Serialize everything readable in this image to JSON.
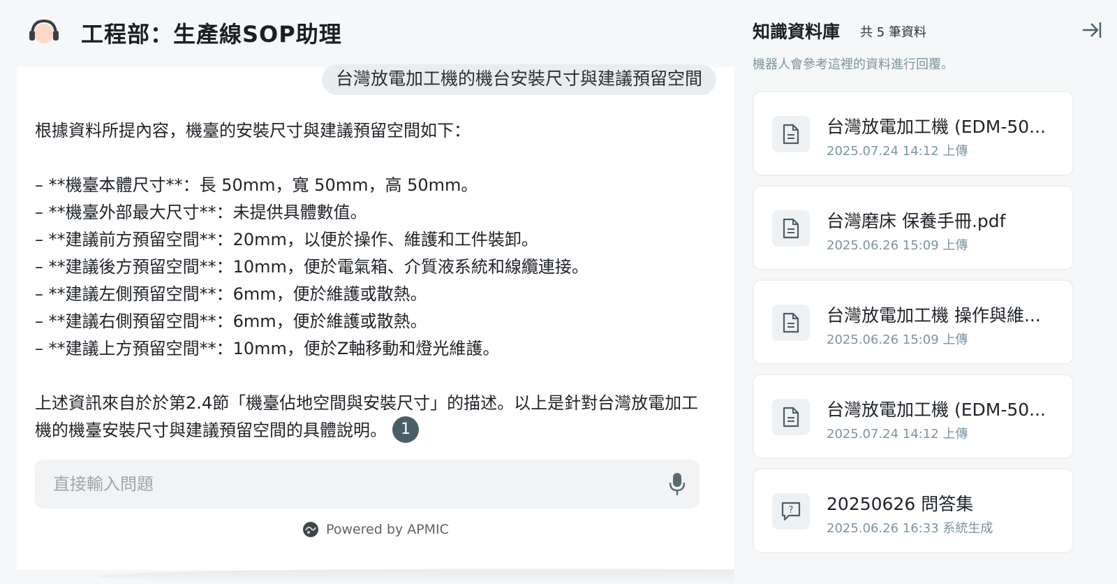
{
  "chat": {
    "title": "工程部：生產線SOP助理",
    "user_message": "台灣放電加工機的機台安裝尺寸與建議預留空間",
    "answer": {
      "intro": "根據資料所提內容，機臺的安裝尺寸與建議預留空間如下：",
      "bullets": [
        "– **機臺本體尺寸**：長 50mm，寬 50mm，高 50mm。",
        "– **機臺外部最大尺寸**：未提供具體數值。",
        "– **建議前方預留空間**：20mm，以便於操作、維護和工件裝卸。",
        "– **建議後方預留空間**：10mm，便於電氣箱、介質液系統和線纜連接。",
        "– **建議左側預留空間**：6mm，便於維護或散熱。",
        "– **建議右側預留空間**：6mm，便於維護或散熱。",
        "– **建議上方預留空間**：10mm，便於Z軸移動和燈光維護。"
      ],
      "conclusion": "上述資訊來自於於第2.4節「機臺佔地空間與安裝尺寸」的描述。以上是針對台灣放電加工機的機臺安裝尺寸與建議預留空間的具體說明。",
      "citation": "1"
    },
    "input_placeholder": "直接輸入問題",
    "powered_by": "Powered by APMIC"
  },
  "knowledge_base": {
    "title": "知識資料庫",
    "count": "共 5 筆資料",
    "description": "機器人會參考這裡的資料進行回覆。",
    "items": [
      {
        "name": "台灣放電加工機 (EDM-50...",
        "meta": "2025.07.24 14:12 上傳",
        "icon": "document-icon"
      },
      {
        "name": "台灣磨床 保養手冊.pdf",
        "meta": "2025.06.26 15:09 上傳",
        "icon": "document-icon"
      },
      {
        "name": "台灣放電加工機 操作與維...",
        "meta": "2025.06.26 15:09 上傳",
        "icon": "document-icon"
      },
      {
        "name": "台灣放電加工機 (EDM-50...",
        "meta": "2025.07.24 14:12 上傳",
        "icon": "document-icon"
      },
      {
        "name": "20250626 問答集",
        "meta": "2025.06.26 16:33 系統生成",
        "icon": "qa-icon"
      }
    ]
  },
  "colors": {
    "accent": "#4a5e67",
    "meta_text": "#7b95a1",
    "bubble": "#e9edef"
  }
}
